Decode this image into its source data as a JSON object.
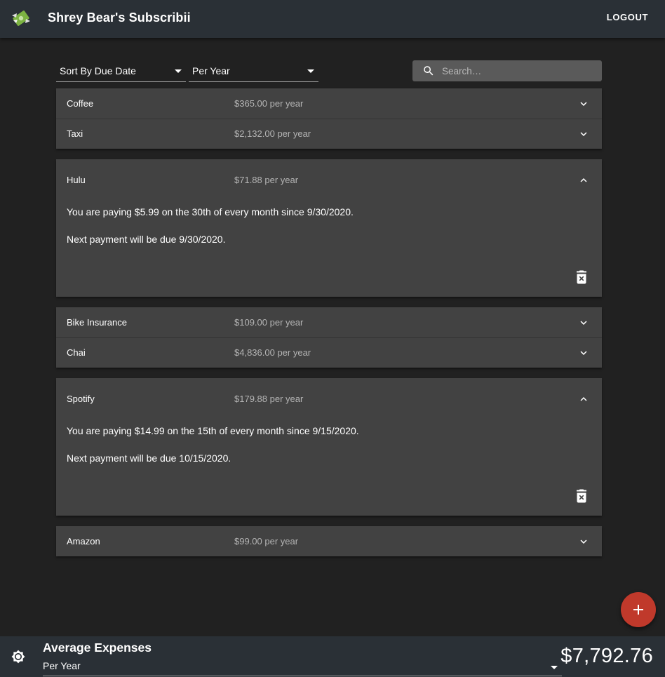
{
  "header": {
    "title": "Shrey Bear's Subscribii",
    "logout_label": "LOGOUT"
  },
  "controls": {
    "sort_selected": "Sort By Due Date",
    "period_selected": "Per Year",
    "search_placeholder": "Search…"
  },
  "subscriptions": [
    {
      "name": "Coffee",
      "cost": "$365.00 per year",
      "expanded": false
    },
    {
      "name": "Taxi",
      "cost": "$2,132.00 per year",
      "expanded": false
    },
    {
      "name": "Hulu",
      "cost": "$71.88 per year",
      "expanded": true,
      "detail": "You are paying $5.99 on the 30th of every month since 9/30/2020.",
      "next_payment": "Next payment will be due 9/30/2020."
    },
    {
      "name": "Bike Insurance",
      "cost": "$109.00 per year",
      "expanded": false
    },
    {
      "name": "Chai",
      "cost": "$4,836.00 per year",
      "expanded": false
    },
    {
      "name": "Spotify",
      "cost": "$179.88 per year",
      "expanded": true,
      "detail": "You are paying $14.99 on the 15th of every month since 9/15/2020.",
      "next_payment": "Next payment will be due 10/15/2020."
    },
    {
      "name": "Amazon",
      "cost": "$99.00 per year",
      "expanded": false
    }
  ],
  "footer": {
    "title": "Average Expenses",
    "period_selected": "Per Year",
    "amount": "$7,792.76"
  },
  "icons": {
    "logo": "money-with-wings-icon",
    "search": "search-icon",
    "expand": "chevron-down-icon",
    "collapse": "chevron-up-icon",
    "delete": "delete-forever-icon",
    "add": "plus-icon",
    "settings": "settings-brightness-icon"
  },
  "colors": {
    "background": "#212121",
    "bar": "#2a3036",
    "panel": "#424242",
    "fab": "#c0392b"
  }
}
